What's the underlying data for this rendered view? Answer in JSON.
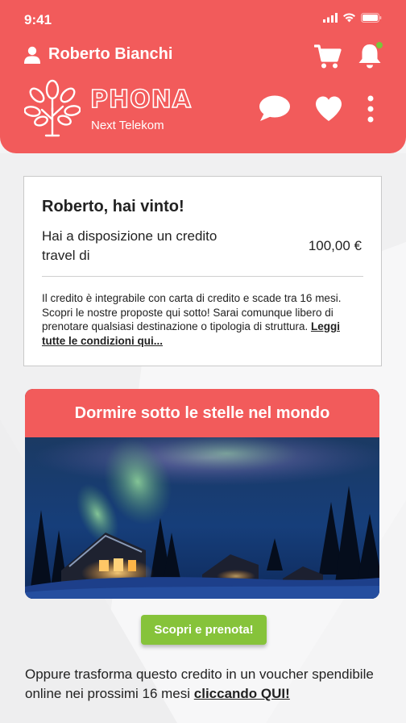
{
  "status_bar": {
    "time": "9:41"
  },
  "header": {
    "user_name": "Roberto Bianchi",
    "brand_name": "PHONA",
    "brand_subtitle": "Next Telekom"
  },
  "prize": {
    "title": "Roberto, hai vinto!",
    "description": "Hai a disposizione un credito travel di",
    "amount": "100,00 €",
    "note": "Il credito è integrabile con carta di credito e scade tra 16 mesi. Scopri le nostre proposte qui sotto! Sarai comunque libero di prenotare qualsiasi destinazione o tipologia di struttura.",
    "conditions_link": "Leggi tutte le condizioni qui..."
  },
  "offer": {
    "title": "Dormire sotto le stelle nel mondo",
    "button_label": "Scopri e prenota!"
  },
  "voucher": {
    "text": "Oppure trasforma questo credito in un voucher spendibile online nei prossimi 16 mesi ",
    "link": "cliccando QUI!"
  },
  "colors": {
    "brand": "#f25b5b",
    "cta": "#86c33a",
    "notification": "#79c63a"
  },
  "icons": [
    "user-icon",
    "cart-icon",
    "bell-icon",
    "chat-icon",
    "heart-icon",
    "more-vertical-icon",
    "signal-icon",
    "wifi-icon",
    "battery-icon",
    "tree-logo-icon"
  ]
}
